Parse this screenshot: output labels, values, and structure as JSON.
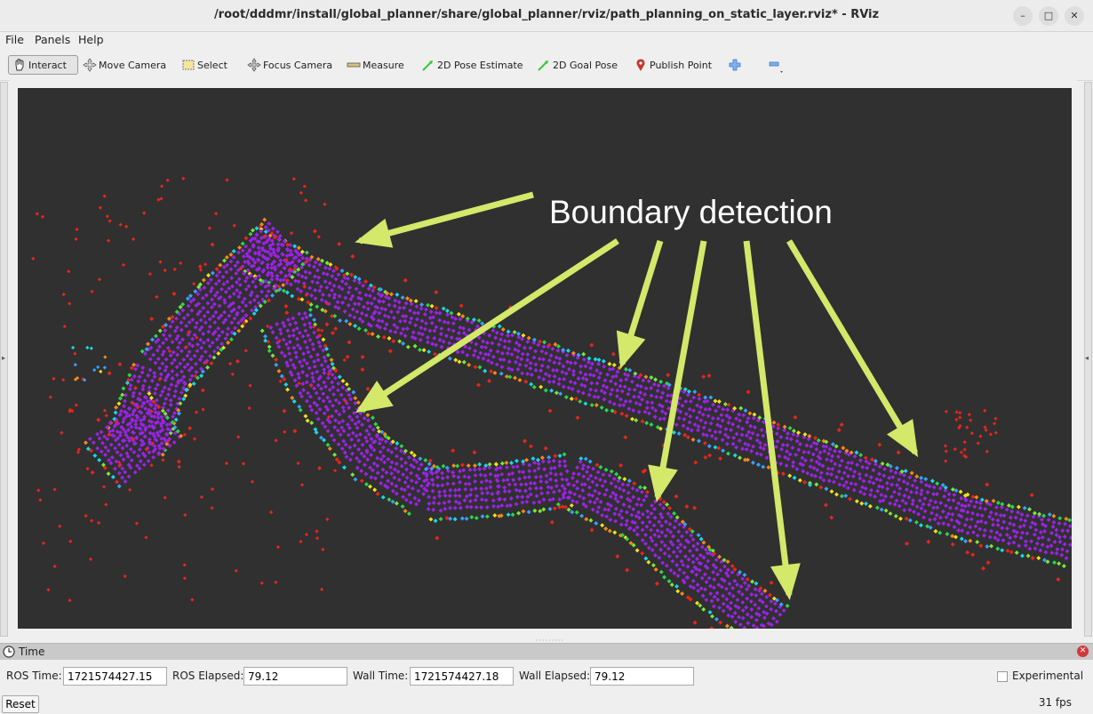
{
  "window": {
    "title": "/root/dddmr/install/global_planner/share/global_planner/rviz/path_planning_on_static_layer.rviz* - RViz"
  },
  "menu": [
    "File",
    "Panels",
    "Help"
  ],
  "toolbar": {
    "interact": "Interact",
    "move_camera": "Move Camera",
    "select": "Select",
    "focus_camera": "Focus Camera",
    "measure": "Measure",
    "pose_estimate": "2D Pose Estimate",
    "goal_pose": "2D Goal Pose",
    "publish_point": "Publish Point"
  },
  "render": {
    "annotation": "Boundary detection",
    "background": "#303030",
    "arrow_color": "#d4e86a"
  },
  "time_panel": {
    "title": "Time",
    "ros_time_label": "ROS Time:",
    "ros_time": "1721574427.15",
    "ros_elapsed_label": "ROS Elapsed:",
    "ros_elapsed": "79.12",
    "wall_time_label": "Wall Time:",
    "wall_time": "1721574427.18",
    "wall_elapsed_label": "Wall Elapsed:",
    "wall_elapsed": "79.12",
    "experimental_label": "Experimental"
  },
  "status": {
    "reset": "Reset",
    "fps": "31 fps"
  }
}
